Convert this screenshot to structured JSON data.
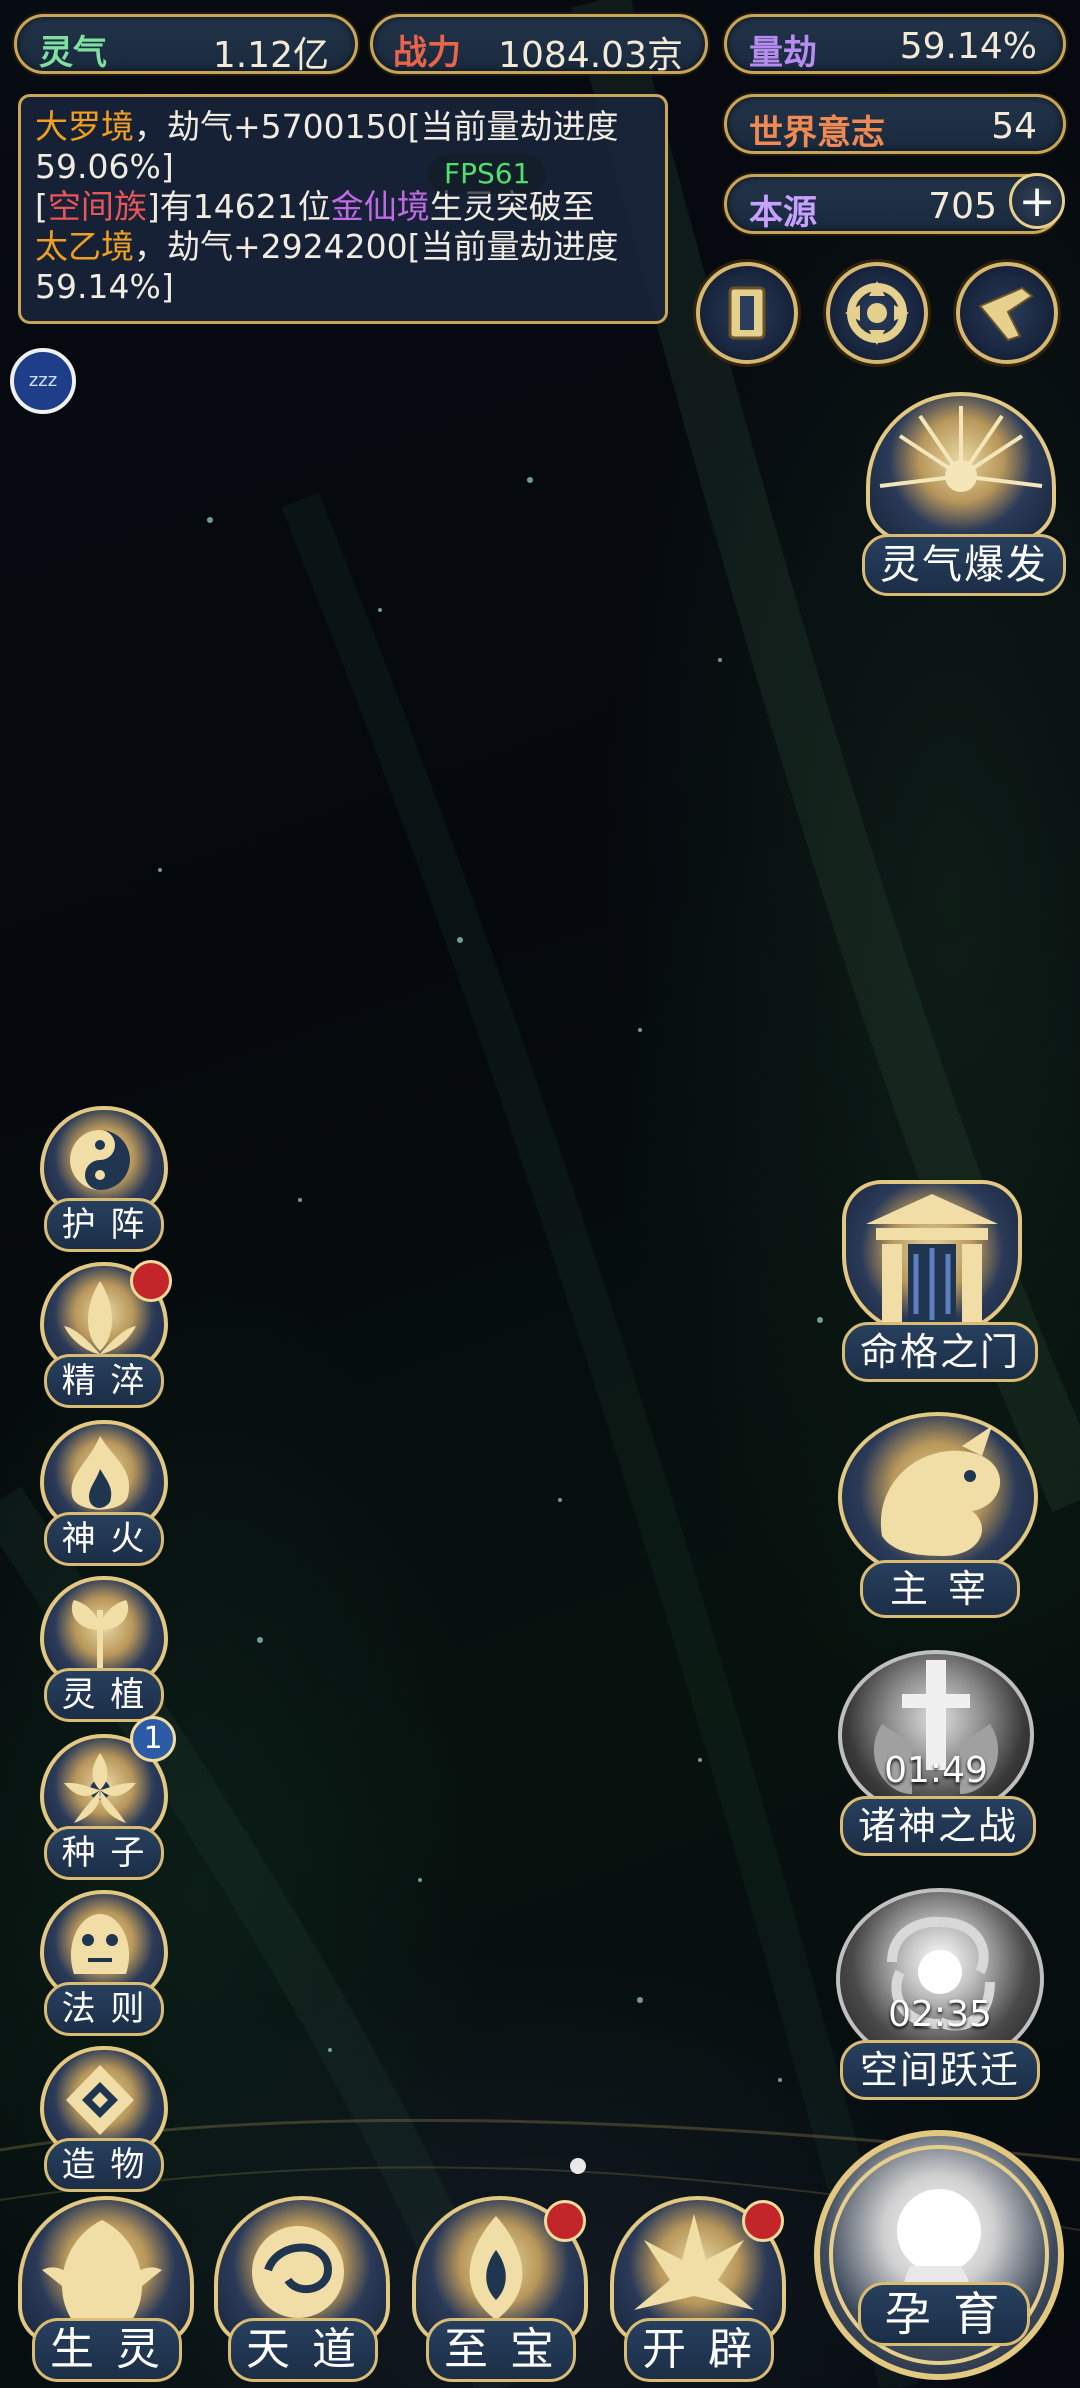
{
  "stats": {
    "lingqi": {
      "label": "灵气",
      "value": "1.12亿",
      "color": "#7fe0a0"
    },
    "zhanli": {
      "label": "战力",
      "value": "1084.03京",
      "color": "#e8654a"
    },
    "liangjie": {
      "label": "量劫",
      "value": "59.14%",
      "color": "#b68cf0"
    },
    "shijie": {
      "label": "世界意志",
      "value": "54",
      "color": "#f08a50"
    },
    "benyuan": {
      "label": "本源",
      "value": "705",
      "color": "#c8a0ff"
    }
  },
  "messages": {
    "line1_realm": "大罗境",
    "line1_rest": "，劫气+5700150[当前量劫进度",
    "line2": "59.06%]",
    "line3_open": "[",
    "line3_clan": "空间族",
    "line3_mid": "]有14621位",
    "line3_realm": "金仙境",
    "line3_tail": "生灵突破至",
    "line4_realm": "太乙境",
    "line4_rest": "，劫气+2924200[当前量劫进度",
    "line5": "59.14%]"
  },
  "fps": "FPS61",
  "zzz": "zzz",
  "top_icons": [
    "card-icon",
    "vortex-icon",
    "horn-icon"
  ],
  "burst": {
    "label": "灵气爆发"
  },
  "left_menu": [
    {
      "id": "huzhen",
      "label": "护 阵",
      "icon": "yinyang-icon"
    },
    {
      "id": "jingcui",
      "label": "精 淬",
      "icon": "lotus-fire-icon",
      "badge": true
    },
    {
      "id": "shenhuo",
      "label": "神 火",
      "icon": "flame-icon"
    },
    {
      "id": "lingzhi",
      "label": "灵 植",
      "icon": "plant-icon"
    },
    {
      "id": "zhongzi",
      "label": "种 子",
      "icon": "flower-icon",
      "count": "1"
    },
    {
      "id": "faze",
      "label": "法 则",
      "icon": "beast-icon"
    },
    {
      "id": "zaowu",
      "label": "造 物",
      "icon": "rune-icon"
    }
  ],
  "right_menu": {
    "mingge": {
      "label": "命格之门"
    },
    "zhuzai": {
      "label": "主 宰"
    },
    "zhushen": {
      "label": "诸神之战",
      "timer": "01:49"
    },
    "kongjian": {
      "label": "空间跃迁",
      "timer": "02:35"
    }
  },
  "bottom_nav": [
    {
      "id": "shengling",
      "label": "生 灵",
      "badge": false
    },
    {
      "id": "tiandao",
      "label": "天 道",
      "badge": false
    },
    {
      "id": "zhibao",
      "label": "至 宝",
      "badge": true
    },
    {
      "id": "kaipi",
      "label": "开 辟",
      "badge": true
    }
  ],
  "yunyu": {
    "label": "孕 育"
  }
}
